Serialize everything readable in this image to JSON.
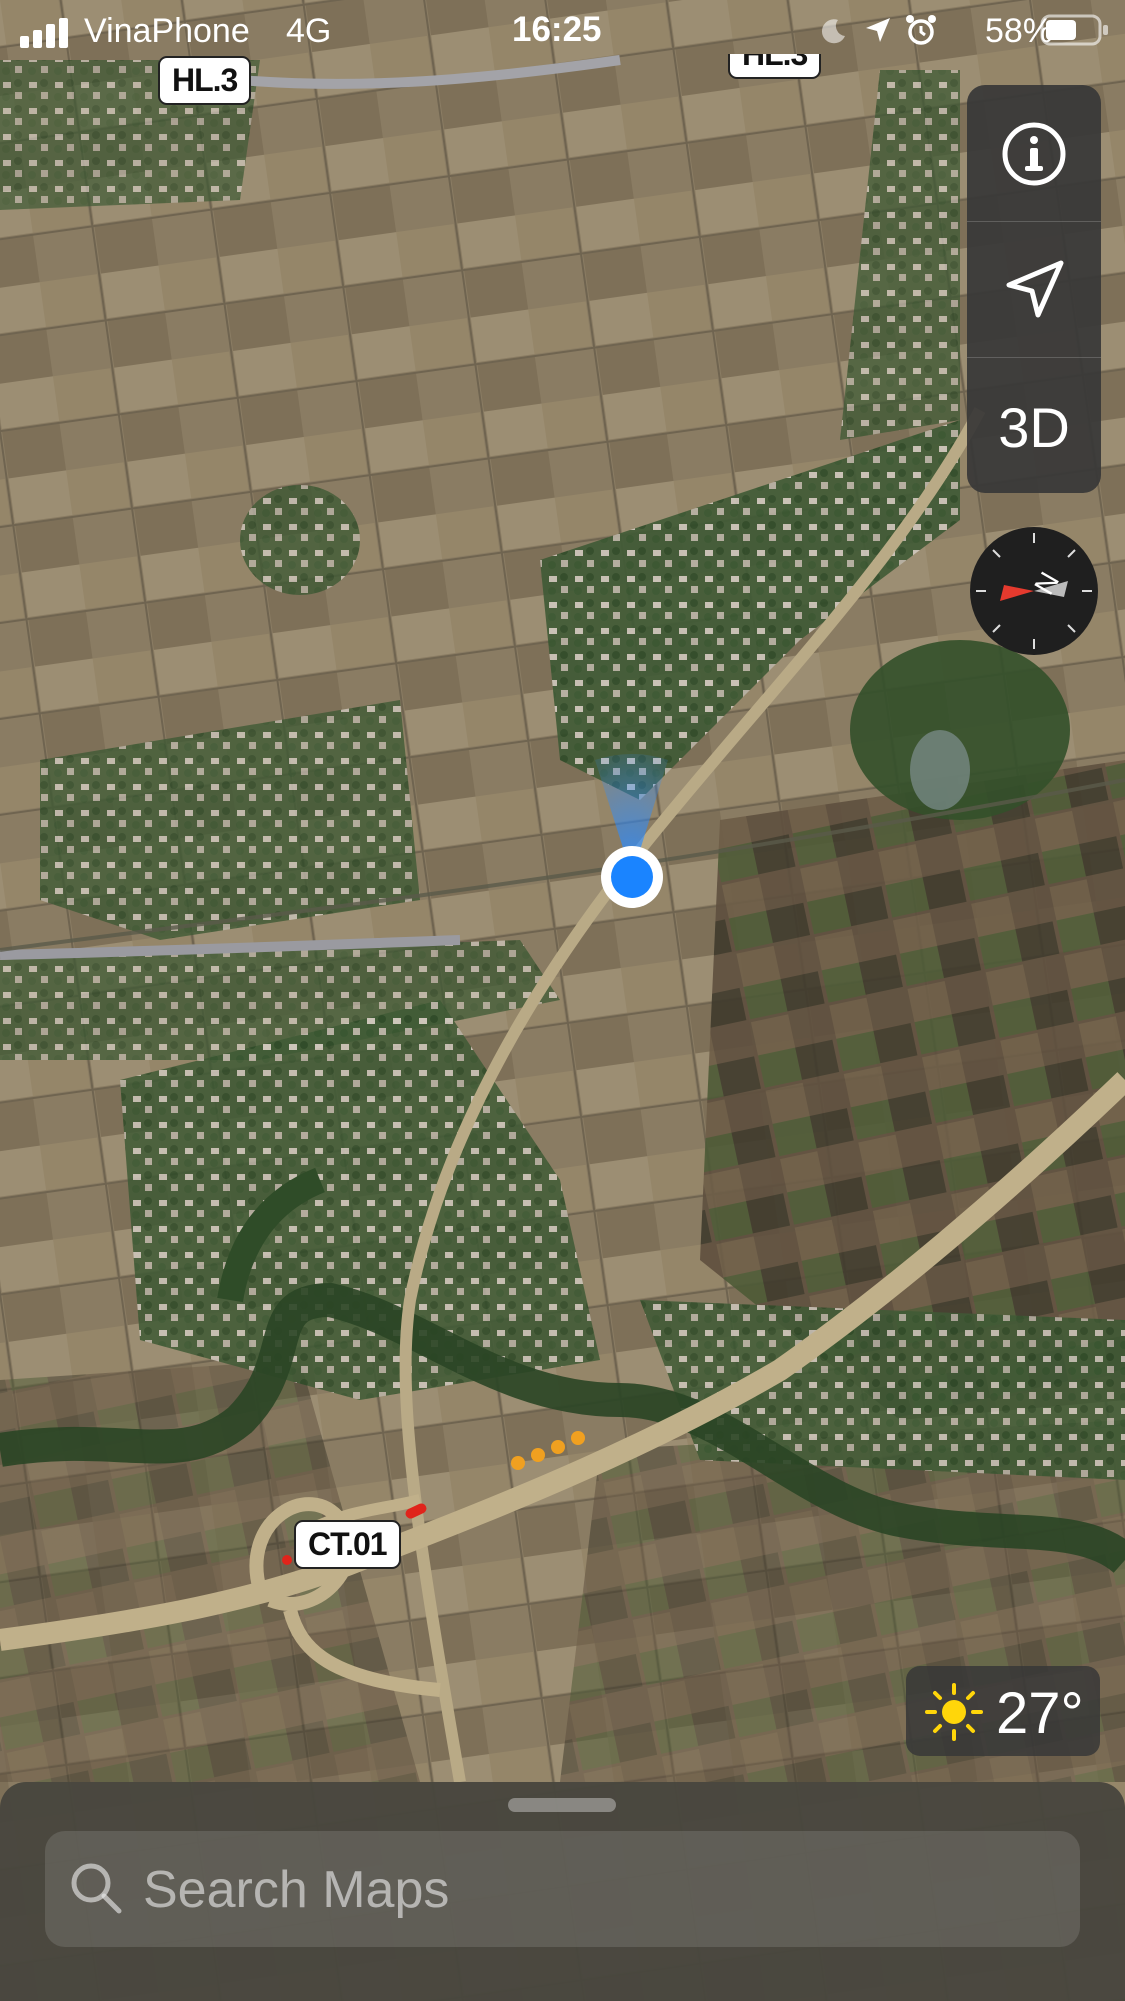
{
  "status_bar": {
    "carrier": "VinaPhone",
    "network": "4G",
    "time": "16:25",
    "battery_percent": "58%",
    "icons": [
      "signal-icon",
      "moon-icon",
      "location-arrow-icon",
      "alarm-icon",
      "battery-icon"
    ]
  },
  "map": {
    "type": "satellite",
    "road_labels": [
      "HL.3",
      "HL.3",
      "CT.01"
    ]
  },
  "controls": {
    "info_icon": "info-icon",
    "locate_icon": "location-arrow-icon",
    "view_3d_label": "3D",
    "compass_icon": "compass-icon"
  },
  "weather": {
    "icon": "sun-icon",
    "temperature": "27°"
  },
  "search": {
    "placeholder": "Search Maps"
  },
  "colors": {
    "user_location": "#1a84ff",
    "compass_needle": "#e53a2e"
  }
}
